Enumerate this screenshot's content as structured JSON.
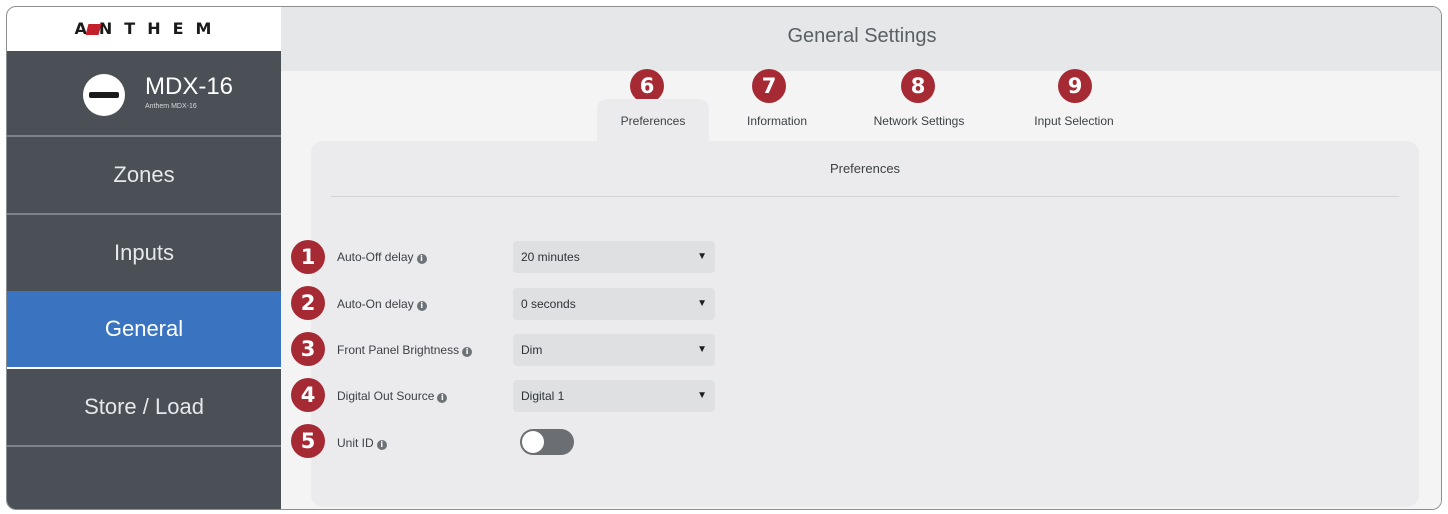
{
  "brand": {
    "logo_text": "ANTHEM",
    "accent_color": "#c4202b"
  },
  "device": {
    "name": "MDX-16",
    "model": "Anthem MDX-16",
    "icon": "device-icon"
  },
  "sidebar": {
    "items": [
      {
        "label": "Zones",
        "active": false
      },
      {
        "label": "Inputs",
        "active": false
      },
      {
        "label": "General",
        "active": true
      },
      {
        "label": "Store / Load",
        "active": false
      }
    ],
    "active_color": "#3a74c0"
  },
  "header": {
    "title": "General Settings"
  },
  "tabs": [
    {
      "label": "Preferences",
      "badge": "6",
      "active": true
    },
    {
      "label": "Information",
      "badge": "7",
      "active": false
    },
    {
      "label": "Network Settings",
      "badge": "8",
      "active": false
    },
    {
      "label": "Input Selection",
      "badge": "9",
      "active": false
    }
  ],
  "panel": {
    "title": "Preferences",
    "rows": [
      {
        "badge": "1",
        "label": "Auto-Off delay",
        "value": "20 minutes"
      },
      {
        "badge": "2",
        "label": "Auto-On delay",
        "value": "0 seconds"
      },
      {
        "badge": "3",
        "label": "Front Panel Brightness",
        "value": "Dim"
      },
      {
        "badge": "4",
        "label": "Digital Out Source",
        "value": "Digital 1"
      }
    ],
    "toggle_row": {
      "badge": "5",
      "label": "Unit ID",
      "on": false
    }
  },
  "info_glyph": "i",
  "caret_glyph": "▼",
  "badge_color": "#a52a34"
}
